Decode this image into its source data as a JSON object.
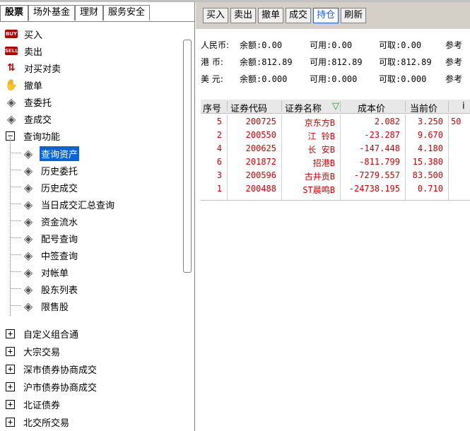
{
  "tabs": [
    {
      "label": "股票",
      "active": true
    },
    {
      "label": "场外基金",
      "active": false
    },
    {
      "label": "理财",
      "active": false
    },
    {
      "label": "服务安全",
      "active": false
    }
  ],
  "tree": {
    "top_items": [
      {
        "label": "买入",
        "icon": "buy-icon",
        "icon_text": "BUY"
      },
      {
        "label": "卖出",
        "icon": "sell-icon",
        "icon_text": "SELL"
      },
      {
        "label": "对买对卖",
        "icon": "swap-icon"
      },
      {
        "label": "撤单",
        "icon": "cancel-hand-icon"
      },
      {
        "label": "查委托",
        "icon": "diamond-icon"
      },
      {
        "label": "查成交",
        "icon": "diamond-icon"
      }
    ],
    "query_group": {
      "label": "查询功能",
      "expander": "−",
      "children": [
        {
          "label": "查询资产",
          "selected": true
        },
        {
          "label": "历史委托"
        },
        {
          "label": "历史成交"
        },
        {
          "label": "当日成交汇总查询"
        },
        {
          "label": "资金流水"
        },
        {
          "label": "配号查询"
        },
        {
          "label": "中签查询"
        },
        {
          "label": "对帐单"
        },
        {
          "label": "股东列表"
        },
        {
          "label": "限售股"
        }
      ]
    },
    "collapsed_groups": [
      {
        "label": "自定义组合通",
        "expander": "+"
      },
      {
        "label": "大宗交易",
        "expander": "+"
      },
      {
        "label": "深市债券协商成交",
        "expander": "+"
      },
      {
        "label": "沪市债券协商成交",
        "expander": "+"
      },
      {
        "label": "北证债券",
        "expander": "+"
      },
      {
        "label": "北交所交易",
        "expander": "+"
      }
    ]
  },
  "toolbar": [
    {
      "label": "买入",
      "active": false
    },
    {
      "label": "卖出",
      "active": false
    },
    {
      "label": "撤单",
      "active": false
    },
    {
      "label": "成交",
      "active": false
    },
    {
      "label": "持仓",
      "active": true
    },
    {
      "label": "刷新",
      "active": false
    }
  ],
  "funds": [
    {
      "currency": "人民币:",
      "balance": "余额:0.00",
      "available": "可用:0.00",
      "withdrawable": "可取:0.00",
      "ref": "参考"
    },
    {
      "currency": "港  币:",
      "balance": "余额:812.89",
      "available": "可用:812.89",
      "withdrawable": "可取:812.89",
      "ref": "参考"
    },
    {
      "currency": "美  元:",
      "balance": "余额:0.000",
      "available": "可用:0.000",
      "withdrawable": "可取:0.000",
      "ref": "参考"
    }
  ],
  "grid": {
    "headers": [
      "序号",
      "证券代码",
      "证券名称",
      "▽",
      "成本价",
      "当前价",
      "i"
    ],
    "rows": [
      {
        "seq": "5",
        "code": "200725",
        "name": "京东方B",
        "cost": "2.082",
        "price": "3.250",
        "extra": "50"
      },
      {
        "seq": "2",
        "code": "200550",
        "name": "江  铃B",
        "cost": "-23.287",
        "price": "9.670",
        "extra": ""
      },
      {
        "seq": "4",
        "code": "200625",
        "name": "长  安B",
        "cost": "-147.448",
        "price": "4.180",
        "extra": ""
      },
      {
        "seq": "6",
        "code": "201872",
        "name": "招港B",
        "cost": "-811.799",
        "price": "15.380",
        "extra": ""
      },
      {
        "seq": "3",
        "code": "200596",
        "name": "古井贡B",
        "cost": "-7279.557",
        "price": "83.500",
        "extra": ""
      },
      {
        "seq": "1",
        "code": "200488",
        "name": "ST晨鸣B",
        "cost": "-24738.195",
        "price": "0.710",
        "extra": ""
      }
    ]
  },
  "colors": {
    "selection": "#0a64d6",
    "row_text": "#d00000",
    "active_button": "#1e5cd6"
  }
}
